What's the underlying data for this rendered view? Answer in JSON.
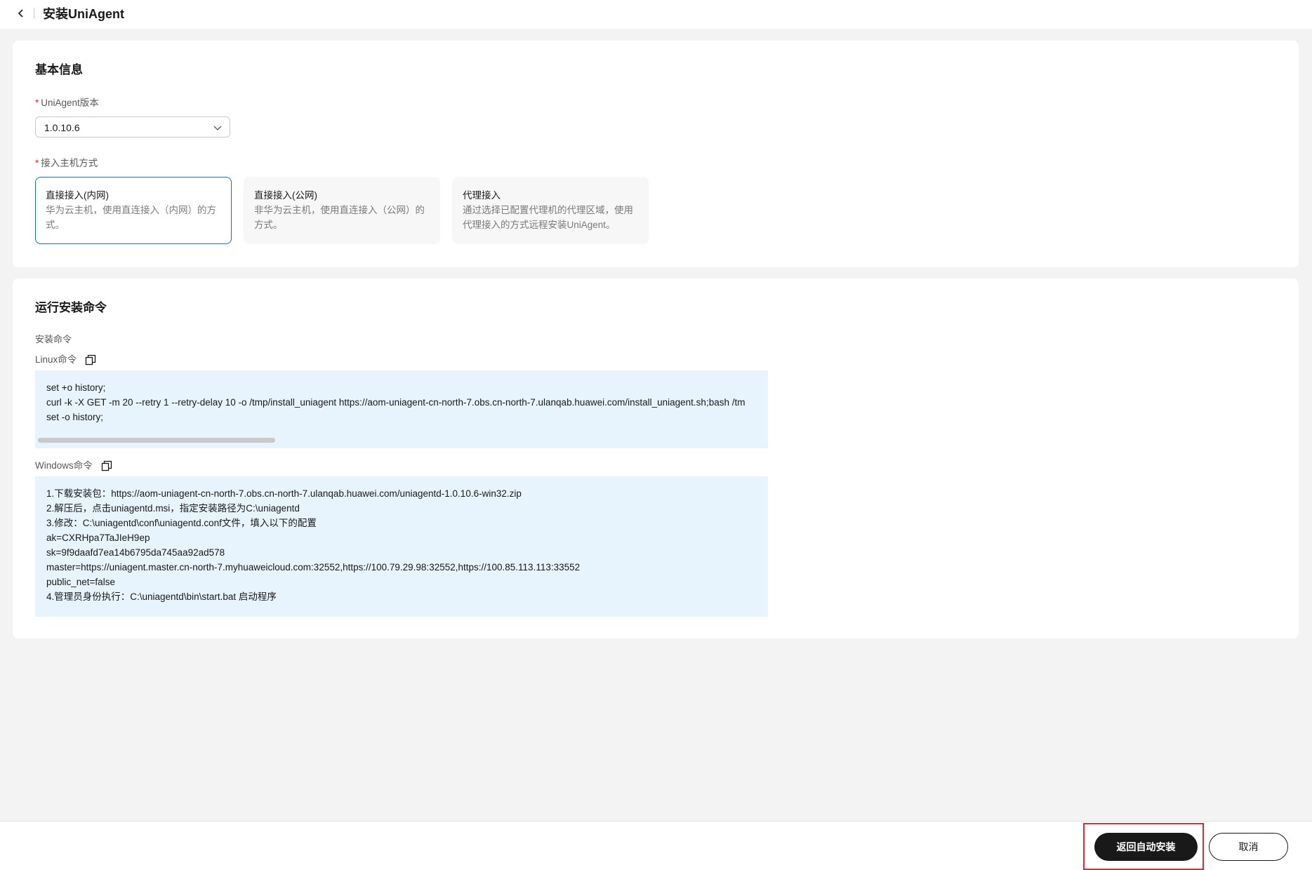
{
  "header": {
    "title": "安装UniAgent",
    "back_icon": "chevron-left-icon"
  },
  "basic_info": {
    "section_title": "基本信息",
    "version_label": "UniAgent版本",
    "version_value": "1.0.10.6",
    "required_mark": "*",
    "access_label": "接入主机方式",
    "access_modes": [
      {
        "title": "直接接入(内网)",
        "desc": "华为云主机，使用直连接入（内网）的方式。",
        "selected": true
      },
      {
        "title": "直接接入(公网)",
        "desc": "非华为云主机，使用直连接入（公网）的方式。",
        "selected": false
      },
      {
        "title": "代理接入",
        "desc": "通过选择已配置代理机的代理区域，使用代理接入的方式远程安装UniAgent。",
        "selected": false
      }
    ]
  },
  "install_cmd": {
    "section_title": "运行安装命令",
    "sub_label": "安装命令",
    "linux": {
      "label": "Linux命令",
      "lines": [
        "set +o history;",
        "curl -k -X GET -m 20 --retry 1 --retry-delay 10 -o /tmp/install_uniagent https://aom-uniagent-cn-north-7.obs.cn-north-7.ulanqab.huawei.com/install_uniagent.sh;bash /tm",
        "set -o history;"
      ]
    },
    "windows": {
      "label": "Windows命令",
      "lines": [
        "1.下载安装包：https://aom-uniagent-cn-north-7.obs.cn-north-7.ulanqab.huawei.com/uniagentd-1.0.10.6-win32.zip",
        "2.解压后，点击uniagentd.msi，指定安装路径为C:\\uniagentd",
        "3.修改：C:\\uniagentd\\conf\\uniagentd.conf文件，填入以下的配置",
        "ak=CXRHpa7TaJIeH9ep",
        "sk=9f9daafd7ea14b6795da745aa92ad578",
        "master=https://uniagent.master.cn-north-7.myhuaweicloud.com:32552,https://100.79.29.98:32552,https://100.85.113.113:33552",
        "public_net=false",
        "4.管理员身份执行：C:\\uniagentd\\bin\\start.bat 启动程序"
      ]
    }
  },
  "footer": {
    "primary_label": "返回自动安装",
    "cancel_label": "取消"
  },
  "colors": {
    "accent": "#0a6ed8",
    "required": "#e6262e",
    "code_bg": "#e8f4fd",
    "primary_button": "#191919"
  }
}
